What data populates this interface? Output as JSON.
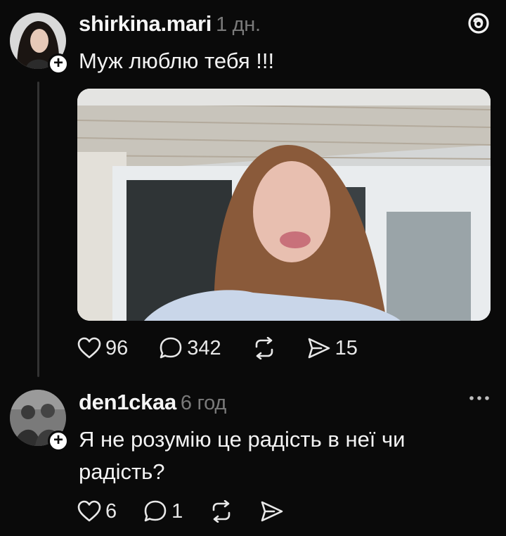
{
  "post": {
    "username": "shirkina.mari",
    "time": "1 дн.",
    "text": "Муж люблю тебя !!!",
    "likes": "96",
    "comments": "342",
    "shares": "15"
  },
  "reply": {
    "username": "den1ckaa",
    "time": "6 год",
    "text_line1": "Я не розумію це радість в неї чи",
    "text_line2": "радість?",
    "likes": "6",
    "comments": "1"
  },
  "icons": {
    "logo": "threads-logo-icon",
    "follow": "plus-icon",
    "like": "heart-icon",
    "comment": "speech-bubble-icon",
    "repost": "repost-icon",
    "share": "send-icon",
    "more": "more-dots-icon"
  },
  "colors": {
    "background": "#0a0a0a",
    "text": "#f3f3f3",
    "muted": "#7a7a7a"
  }
}
